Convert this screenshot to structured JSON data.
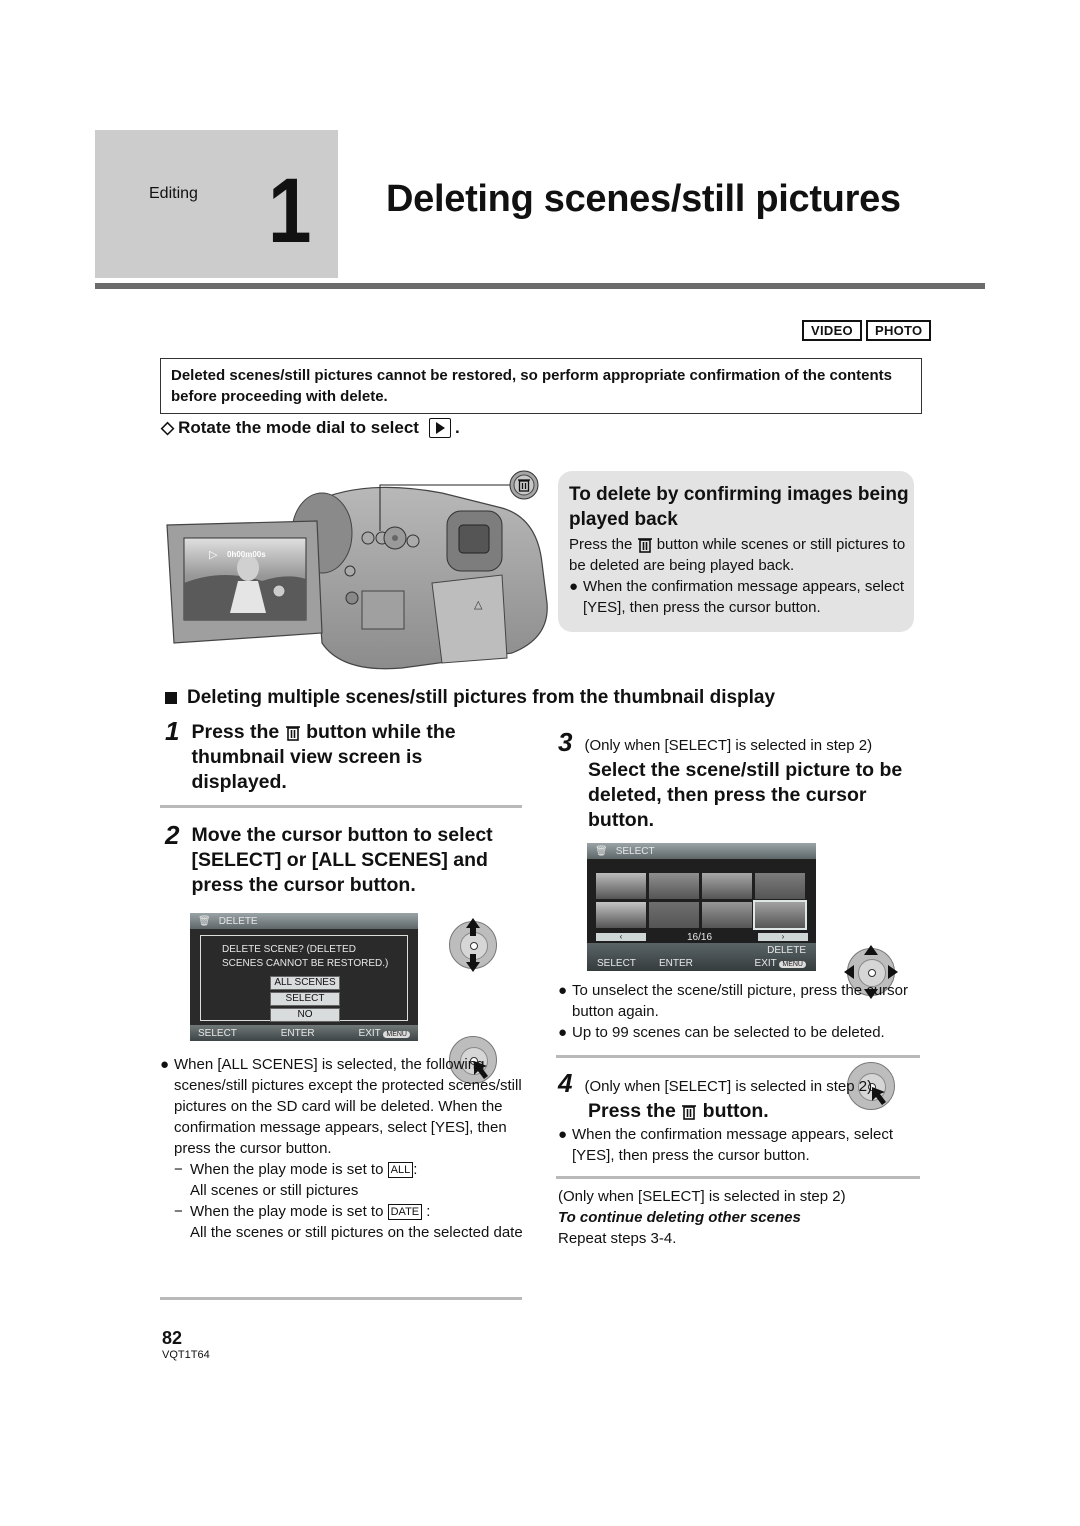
{
  "header": {
    "category": "Editing",
    "chapter_number": "1",
    "title": "Deleting scenes/still pictures"
  },
  "mode_badges": [
    "VIDEO",
    "PHOTO"
  ],
  "warning": "Deleted scenes/still pictures cannot be restored, so perform appropriate confirmation of the contents before proceeding with delete.",
  "prep_step": {
    "prefix": "Rotate the mode dial to select",
    "suffix": ".",
    "icon": "playback-mode-icon"
  },
  "camera_illustration": {
    "screen_time": "0h00m00s",
    "callout_icon": "trash-icon"
  },
  "info_box": {
    "title": "To delete by confirming images being played back",
    "body_prefix": "Press the",
    "body_suffix": "button while scenes or still pictures to be deleted are being played back.",
    "bullet": "When the confirmation message appears, select [YES], then press the cursor button."
  },
  "section": {
    "title": "Deleting multiple scenes/still pictures from the thumbnail display"
  },
  "steps": [
    {
      "number": "1",
      "text_prefix": "Press the",
      "text_suffix": "button while the thumbnail view screen is displayed."
    },
    {
      "number": "2",
      "text": "Move the cursor button to select [SELECT] or [ALL SCENES] and press the cursor button.",
      "screen": {
        "title": "DELETE",
        "message_line1": "DELETE SCENE? (DELETED",
        "message_line2": "SCENES CANNOT BE RESTORED.)",
        "options": [
          "ALL SCENES",
          "SELECT",
          "NO"
        ],
        "footer_left": "SELECT",
        "footer_mid": "ENTER",
        "footer_right": "EXIT",
        "menu_label": "MENU"
      },
      "notes": {
        "bullet": "When [ALL SCENES] is selected, the following scenes/still pictures except the protected scenes/still pictures on the SD card will be deleted. When the confirmation message appears, select [YES], then press the cursor button.",
        "sub": [
          {
            "prefix": "When the play mode is set to",
            "icon": "ALL",
            "desc": "All scenes or still pictures"
          },
          {
            "prefix": "When the play mode is set to",
            "icon": "DATE",
            "desc": "All the scenes or still pictures on the selected date"
          }
        ]
      }
    },
    {
      "number": "3",
      "condition": "(Only when [SELECT] is selected in step 2)",
      "text": "Select the scene/still picture to be deleted, then press the cursor button.",
      "screen": {
        "title": "SELECT",
        "page": "16/16",
        "delete_label": "DELETE",
        "footer_left": "SELECT",
        "footer_mid": "ENTER",
        "footer_right": "EXIT",
        "menu_label": "MENU"
      },
      "notes": [
        "To unselect the scene/still picture, press the cursor button again.",
        "Up to 99 scenes can be selected to be deleted."
      ]
    },
    {
      "number": "4",
      "condition": "(Only when [SELECT] is selected in step 2)",
      "text_prefix": "Press the",
      "text_suffix": "button.",
      "note": "When the confirmation message appears, select [YES], then press the cursor button."
    }
  ],
  "continue_block": {
    "condition": "(Only when [SELECT] is selected in step 2)",
    "heading": "To continue deleting other scenes",
    "text": "Repeat steps 3-4."
  },
  "footer": {
    "page_number": "82",
    "model_code": "VQT1T64"
  },
  "bullet_char": "●",
  "dash_char": "−",
  "diamond_char": "◇"
}
